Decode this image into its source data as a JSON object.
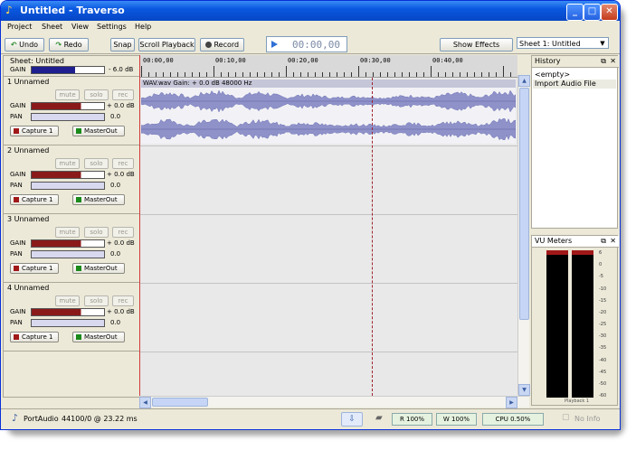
{
  "window": {
    "title": "Untitled - Traverso"
  },
  "menu": [
    "Project",
    "Sheet",
    "View",
    "Settings",
    "Help"
  ],
  "toolbar": {
    "undo": "Undo",
    "redo": "Redo",
    "snap": "Snap",
    "scroll_playback": "Scroll Playback",
    "record": "Record",
    "time": "00:00,00",
    "show_effects": "Show Effects",
    "sheet_select": "Sheet 1: Untitled"
  },
  "sheet": {
    "label": "Sheet: Untitled",
    "gain_label": "GAIN",
    "gain_value": "- 6.0 dB"
  },
  "track_labels": {
    "mute": "mute",
    "solo": "solo",
    "rec": "rec",
    "gain": "GAIN",
    "pan": "PAN",
    "capture": "Capture 1",
    "masterout": "MasterOut"
  },
  "tracks": [
    {
      "name": "1 Unnamed",
      "gain": "+ 0.0 dB",
      "pan": "0.0"
    },
    {
      "name": "2 Unnamed",
      "gain": "+ 0.0 dB",
      "pan": "0.0"
    },
    {
      "name": "3 Unnamed",
      "gain": "+ 0.0 dB",
      "pan": "0.0"
    },
    {
      "name": "4 Unnamed",
      "gain": "+ 0.0 dB",
      "pan": "0.0"
    }
  ],
  "ruler": [
    "00:00,00",
    "00:10,00",
    "00:20,00",
    "00:30,00",
    "00:40,00"
  ],
  "clip": {
    "header": "WAV.wav    Gain: + 0.0 dB   48000 Hz"
  },
  "history": {
    "title": "History",
    "items": [
      "<empty>",
      "Import Audio File"
    ]
  },
  "vu": {
    "title": "VU Meters",
    "scale": [
      "6",
      "0",
      "-5",
      "-10",
      "-15",
      "-20",
      "-25",
      "-30",
      "-35",
      "-40",
      "-45",
      "-50",
      "-60"
    ],
    "label": "Playback 1"
  },
  "status": {
    "driver": "PortAudio",
    "rate": "44100/0 @ 23.22 ms",
    "read": "R 100%",
    "write": "W 100%",
    "cpu": "CPU 0.50%",
    "info": "No Info"
  }
}
